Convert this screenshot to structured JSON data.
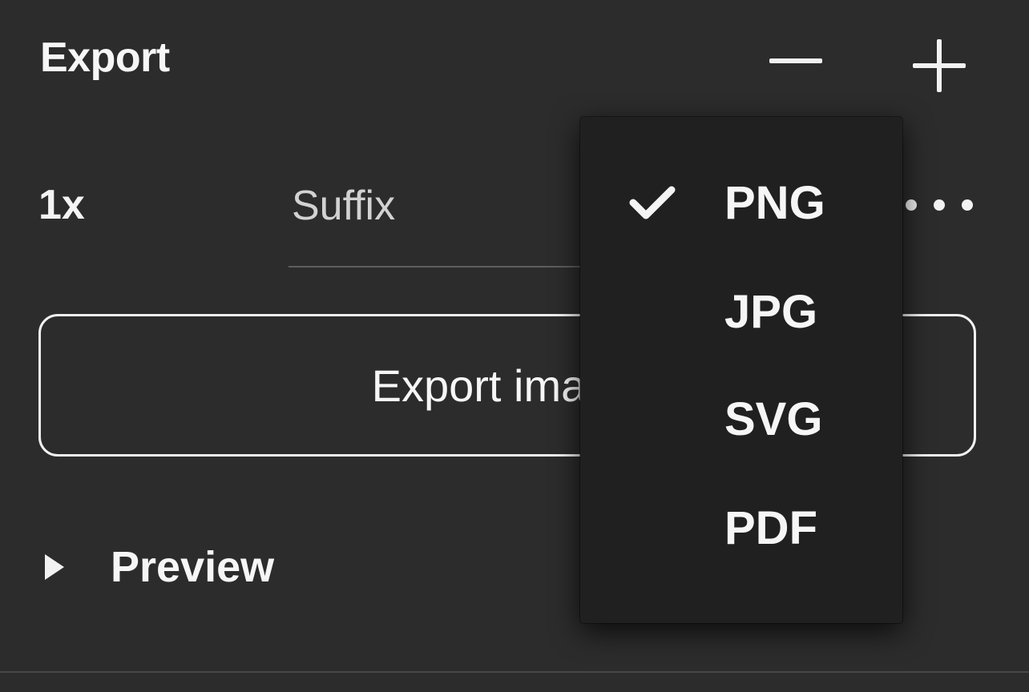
{
  "panel": {
    "title": "Export",
    "icons": {
      "remove": "minus-icon",
      "add": "plus-icon",
      "more": "more-horizontal-icon",
      "expand": "caret-right-icon",
      "selected": "check-icon"
    }
  },
  "export_row": {
    "scale_value": "1x",
    "suffix_placeholder": "Suffix",
    "suffix_value": ""
  },
  "export_button": {
    "label_visible": "Export imag"
  },
  "preview": {
    "label": "Preview"
  },
  "format_menu": {
    "selected": "PNG",
    "items": [
      {
        "label": "PNG"
      },
      {
        "label": "JPG"
      },
      {
        "label": "SVG"
      },
      {
        "label": "PDF"
      }
    ]
  },
  "colors": {
    "panel_background": "#2c2c2c",
    "menu_background": "#202020",
    "text": "#f6f6f6"
  }
}
